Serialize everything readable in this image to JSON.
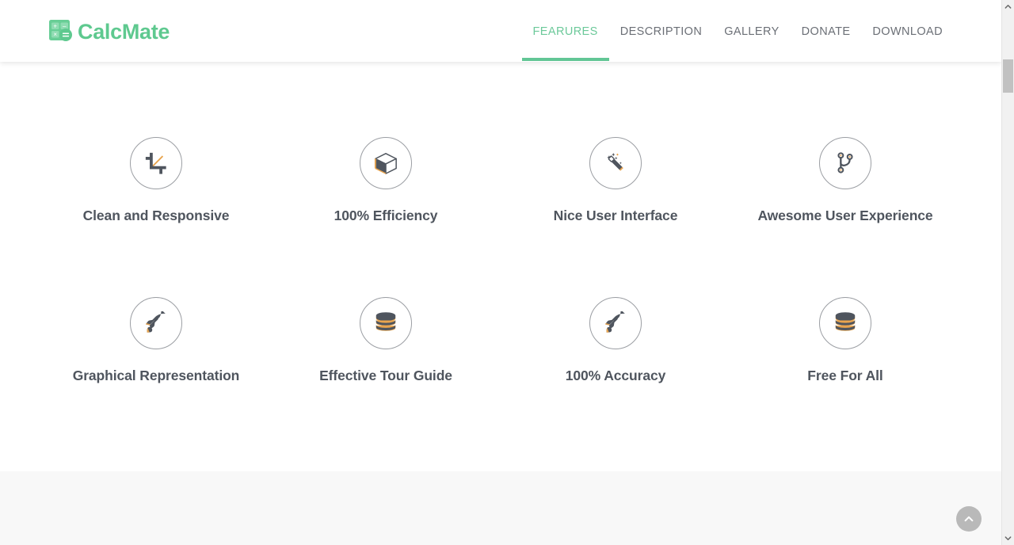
{
  "header": {
    "brand": {
      "name": "CalcMate",
      "icon": "calculator-icon",
      "keys": [
        "+",
        "−",
        "×",
        "="
      ],
      "color": "#5ec98f"
    },
    "nav": {
      "active_index": 0,
      "accent_color": "#62c695",
      "items": [
        {
          "label": "FEARURES",
          "active": true
        },
        {
          "label": "DESCRIPTION",
          "active": false
        },
        {
          "label": "GALLERY",
          "active": false
        },
        {
          "label": "DONATE",
          "active": false
        },
        {
          "label": "DOWNLOAD",
          "active": false
        }
      ]
    }
  },
  "features": {
    "icon_color": "#4f555e",
    "icon_accent_color": "#e8a44f",
    "circle_border_color": "#9b9ea3",
    "items": [
      {
        "title": "Clean and Responsive",
        "icon": "crop-alt-icon"
      },
      {
        "title": "100% Efficiency",
        "icon": "cube-icon"
      },
      {
        "title": "Nice User Interface",
        "icon": "magic-wand-icon"
      },
      {
        "title": "Awesome User Experience",
        "icon": "code-branch-icon"
      },
      {
        "title": "Graphical Representation",
        "icon": "rocket-icon"
      },
      {
        "title": "Effective Tour Guide",
        "icon": "database-icon"
      },
      {
        "title": "100% Accuracy",
        "icon": "rocket-icon"
      },
      {
        "title": "Free For All",
        "icon": "database-icon"
      }
    ]
  },
  "scroll_top_button": {
    "label": "Back to top",
    "icon": "chevron-up-icon",
    "color": "#b9b9b9"
  },
  "scrollbar": {
    "up_icon": "chevron-up-icon",
    "down_icon": "chevron-down-icon"
  }
}
